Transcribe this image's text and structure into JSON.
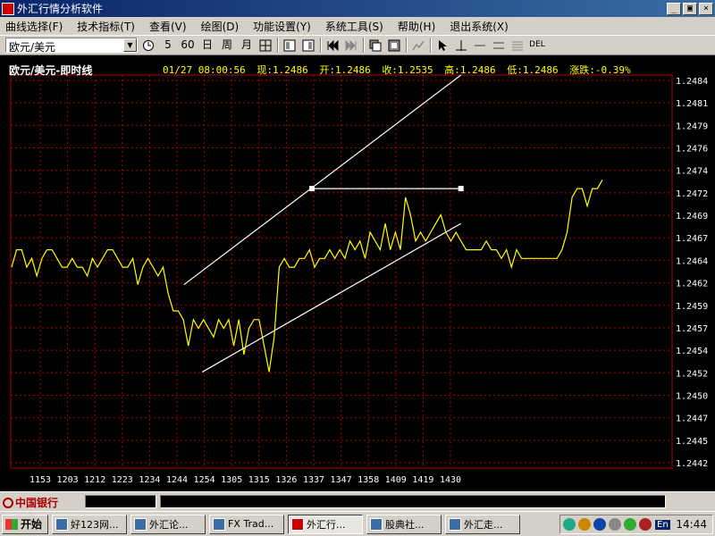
{
  "window": {
    "title": "外汇行情分析软件",
    "controls": [
      "_",
      "▣",
      "×"
    ]
  },
  "menu": [
    "曲线选择(F)",
    "技术指标(T)",
    "查看(V)",
    "绘图(D)",
    "功能设置(Y)",
    "系统工具(S)",
    "帮助(H)",
    "退出系统(X)"
  ],
  "toolbar": {
    "pair_select": "欧元/美元",
    "period_5": "5",
    "period_60": "60",
    "period_day": "日",
    "period_week": "周",
    "period_month": "月",
    "del_label": "DEL"
  },
  "chart_header": {
    "title": "欧元/美元-即时线",
    "datetime": "01/27 08:00:56",
    "now": "现:1.2486",
    "open": "开:1.2486",
    "close": "收:1.2535",
    "high": "高:1.2486",
    "low": "低:1.2486",
    "change": "涨跌:-0.39%"
  },
  "colors": {
    "line": "#ffff00",
    "grid": "#b00000",
    "axis_text": "#ffff00",
    "bg": "#000000"
  },
  "chart_data": {
    "type": "line",
    "ylim": [
      1.2441,
      1.2486
    ],
    "y_ticks": [
      "1.2484",
      "1.2481",
      "1.2479",
      "1.2476",
      "1.2474",
      "1.2472",
      "1.2469",
      "1.2467",
      "1.2464",
      "1.2462",
      "1.2459",
      "1.2457",
      "1.2454",
      "1.2452",
      "1.2450",
      "1.2447",
      "1.2445",
      "1.2442"
    ],
    "x_ticks": [
      "1153",
      "1203",
      "1212",
      "1223",
      "1234",
      "1244",
      "1254",
      "1305",
      "1315",
      "1326",
      "1337",
      "1347",
      "1358",
      "1409",
      "1419",
      "1430"
    ],
    "series": [
      {
        "values": [
          1.2464,
          1.2466,
          1.2466,
          1.2464,
          1.2465,
          1.2463,
          1.2465,
          1.2466,
          1.2466,
          1.2465,
          1.2464,
          1.2464,
          1.2465,
          1.2464,
          1.2464,
          1.2463,
          1.2465,
          1.2464,
          1.2465,
          1.2466,
          1.2466,
          1.2465,
          1.2464,
          1.2464,
          1.2465,
          1.2462,
          1.2464,
          1.2465,
          1.2464,
          1.2463,
          1.2464,
          1.2461,
          1.2459,
          1.2459,
          1.2458,
          1.2455,
          1.2458,
          1.2457,
          1.2458,
          1.2457,
          1.2456,
          1.2458,
          1.2457,
          1.2458,
          1.2455,
          1.2458,
          1.2454,
          1.2457,
          1.2458,
          1.2458,
          1.2455,
          1.2452,
          1.2456,
          1.2464,
          1.2465,
          1.2464,
          1.2464,
          1.2465,
          1.2465,
          1.2466,
          1.2464,
          1.2465,
          1.2465,
          1.2466,
          1.2465,
          1.2466,
          1.2465,
          1.2467,
          1.2466,
          1.2467,
          1.2465,
          1.2468,
          1.2467,
          1.2466,
          1.2469,
          1.2466,
          1.2468,
          1.2466,
          1.2472,
          1.247,
          1.2467,
          1.2468,
          1.2467,
          1.2468,
          1.2469,
          1.247,
          1.2468,
          1.2467,
          1.2468,
          1.2467,
          1.2466,
          1.2466,
          1.2466,
          1.2466,
          1.2467,
          1.2466,
          1.2466,
          1.2465,
          1.2466,
          1.2464,
          1.2466,
          1.2465,
          1.2465,
          1.2465,
          1.2465,
          1.2465,
          1.2465,
          1.2465,
          1.2465,
          1.2466,
          1.2468,
          1.2472,
          1.2473,
          1.2473,
          1.2471,
          1.2473,
          1.2473,
          1.2474
        ]
      }
    ],
    "trendlines": [
      {
        "from": [
          1248,
          1.2462
        ],
        "to": [
          1434,
          1.2486
        ]
      },
      {
        "from": [
          1255,
          1.2452
        ],
        "to": [
          1434,
          1.2469
        ]
      },
      {
        "from": [
          1337,
          1.2473
        ],
        "to": [
          1434,
          1.2473
        ]
      }
    ],
    "grid": true
  },
  "taskbar": {
    "start": "开始",
    "items": [
      "好123网...",
      "外汇论...",
      "FX Trad...",
      "外汇行...",
      "股典社...",
      "外汇走..."
    ],
    "active_index": 3,
    "ime": "En",
    "clock": "14:44"
  },
  "statusbar": {
    "logo": "中国银行"
  }
}
